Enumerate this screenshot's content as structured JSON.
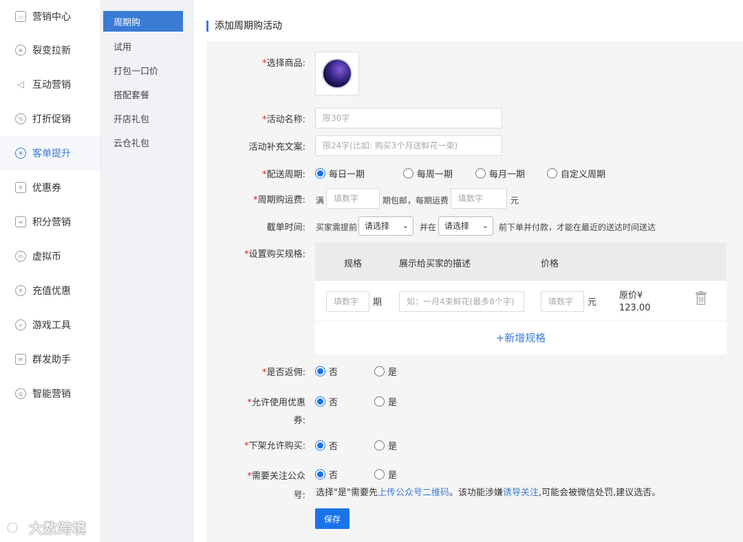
{
  "sidebar": {
    "items": [
      {
        "label": "营销中心",
        "icon": "chart-icon"
      },
      {
        "label": "裂变拉新",
        "icon": "fission-icon"
      },
      {
        "label": "互动营销",
        "icon": "send-icon"
      },
      {
        "label": "打折促销",
        "icon": "discount-icon"
      },
      {
        "label": "客单提升",
        "icon": "yen-icon"
      },
      {
        "label": "优惠券",
        "icon": "coupon-icon"
      },
      {
        "label": "积分营销",
        "icon": "points-icon"
      },
      {
        "label": "虚拟币",
        "icon": "coin-icon"
      },
      {
        "label": "充值优惠",
        "icon": "recharge-icon"
      },
      {
        "label": "游戏工具",
        "icon": "gamepad-icon"
      },
      {
        "label": "群发助手",
        "icon": "mail-icon"
      },
      {
        "label": "智能营销",
        "icon": "target-icon"
      }
    ],
    "active_index": 4
  },
  "submenu": {
    "items": [
      "周期购",
      "试用",
      "打包一口价",
      "搭配套餐",
      "开店礼包",
      "云仓礼包"
    ],
    "active_index": 0
  },
  "form": {
    "title": "添加周期购活动",
    "required_mark": "*",
    "product": {
      "label": "选择商品:"
    },
    "activity_name": {
      "label": "活动名称:",
      "placeholder": "限30字"
    },
    "supplement": {
      "label": "活动补充文案:",
      "placeholder": "限24字(比如: 购买3个月送鲜花一束)"
    },
    "delivery_cycle": {
      "label": "配送周期:",
      "options": [
        "每日一期",
        "每周一期",
        "每月一期",
        "自定义周期"
      ],
      "selected": "每日一期"
    },
    "shipping": {
      "label": "周期购运费:",
      "prefix": "满",
      "input1_placeholder": "填数字",
      "middle": "期包邮，每期运费",
      "input2_placeholder": "填数字",
      "suffix": "元"
    },
    "cutoff": {
      "label": "截单时间:",
      "prefix": "买家需提前",
      "select1": "请选择",
      "middle": "并在",
      "select2": "请选择",
      "suffix": "前下单并付款，才能在最近的送达时间送达"
    },
    "spec": {
      "label": "设置购买规格:",
      "headers": [
        "规格",
        "展示给买家的描述",
        "价格"
      ],
      "row": {
        "spec_placeholder": "填数字",
        "spec_unit": "期",
        "desc_placeholder": "如：一月4束鲜花(最多8个字)",
        "price_placeholder": "填数字",
        "price_unit": "元",
        "original_price_label": "原价¥",
        "original_price_value": "123.00"
      },
      "add_label": "+新增规格"
    },
    "rebate": {
      "label": "是否返佣:",
      "options": [
        "否",
        "是"
      ],
      "selected": "否"
    },
    "coupon": {
      "label_line1": "允许使用优惠",
      "label_line2": "券:",
      "options": [
        "否",
        "是"
      ],
      "selected": "否"
    },
    "offshelf": {
      "label": "下架允许购买:",
      "options": [
        "否",
        "是"
      ],
      "selected": "否"
    },
    "follow": {
      "label_line1": "需要关注公众",
      "label_line2": "号:",
      "options": [
        "否",
        "是"
      ],
      "selected": "否",
      "hint_part1": "选择\"是\"需要先",
      "hint_link1": "上传公众号二维码",
      "hint_part2": "。该功能涉嫌",
      "hint_link2": "诱导关注",
      "hint_part3": ",可能会被微信处罚,建议选否。"
    },
    "save_label": "保存"
  },
  "watermark": "大数跨境",
  "colors": {
    "accent": "#3a7bd5",
    "radio": "#1a73e8",
    "required": "#e02020"
  }
}
